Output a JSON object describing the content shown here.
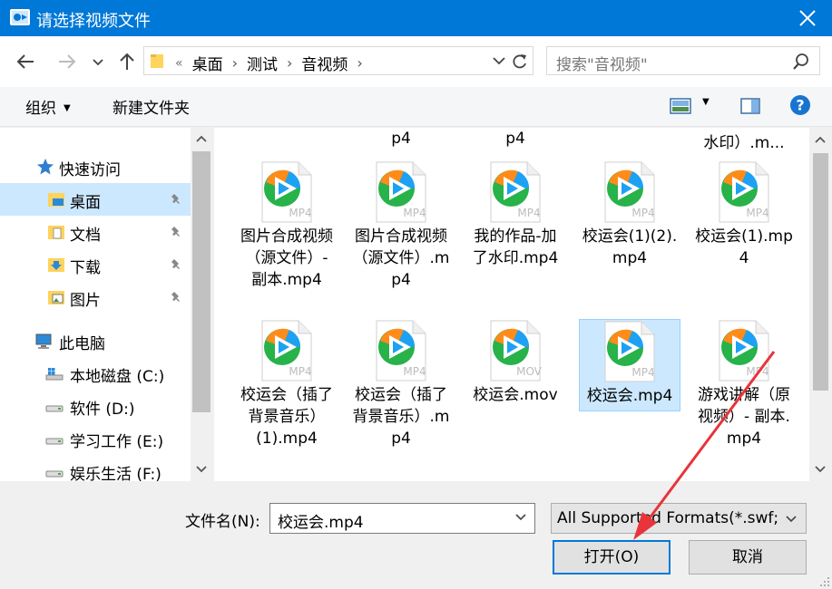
{
  "window": {
    "title": "请选择视频文件"
  },
  "address": {
    "lead": "«",
    "crumbs": [
      "桌面",
      "测试",
      "音视频"
    ]
  },
  "search": {
    "placeholder": "搜索\"音视频\""
  },
  "toolbar": {
    "organize": "组织",
    "new_folder": "新建文件夹"
  },
  "nav": {
    "quick_access": "快速访问",
    "items": [
      {
        "label": "桌面",
        "icon": "desktop-folder-icon",
        "pinned": true
      },
      {
        "label": "文档",
        "icon": "documents-folder-icon",
        "pinned": true
      },
      {
        "label": "下载",
        "icon": "downloads-folder-icon",
        "pinned": true
      },
      {
        "label": "图片",
        "icon": "pictures-folder-icon",
        "pinned": true
      }
    ],
    "this_pc": "此电脑",
    "drives": [
      "本地磁盘 (C:)",
      "软件 (D:)",
      "学习工作 (E:)",
      "娱乐生活 (F:)"
    ]
  },
  "files": {
    "partial_top": [
      "p4",
      "p4",
      "水印）.m..."
    ],
    "row1": [
      {
        "name": "图片合成视频（源文件）- 副本.mp4",
        "ext": "MP4"
      },
      {
        "name": "图片合成视频（源文件）.mp4",
        "ext": "MP4"
      },
      {
        "name": "我的作品-加了水印.mp4",
        "ext": "MP4"
      },
      {
        "name": "校运会(1)(2).mp4",
        "ext": "MP4"
      },
      {
        "name": "校运会(1).mp4",
        "ext": "MP4"
      }
    ],
    "row2": [
      {
        "name": "校运会（插了背景音乐）(1).mp4",
        "ext": "MP4"
      },
      {
        "name": "校运会（插了背景音乐）.mp4",
        "ext": "MP4"
      },
      {
        "name": "校运会.mov",
        "ext": "MOV"
      },
      {
        "name": "校运会.mp4",
        "ext": "MP4",
        "selected": true
      },
      {
        "name": "游戏讲解（原视频）- 副本.mp4",
        "ext": "MP4"
      }
    ]
  },
  "bottom": {
    "filename_label": "文件名(N):",
    "filename_value": "校运会.mp4",
    "filter_value": "All Supported Formats(*.swf;",
    "open_label": "打开(O)",
    "cancel_label": "取消"
  },
  "colors": {
    "titlebar": "#0078d7",
    "selection": "#cce8ff",
    "arrow": "#e8343a"
  }
}
